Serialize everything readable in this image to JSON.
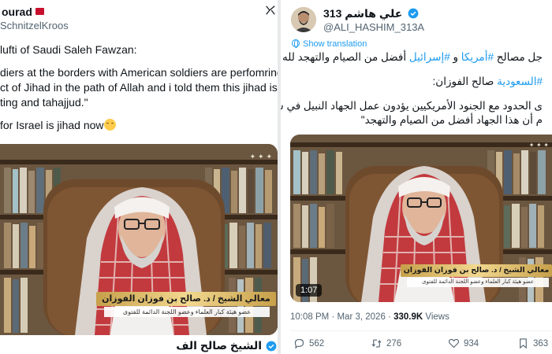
{
  "left": {
    "name_fragment": "ourad",
    "handle": "SchnitzelKroos",
    "lines": [
      "lufti of Saudi Saleh Fawzan:",
      "",
      "diers at the borders with American soldiers are perfomring th",
      "ct of Jihad in the path of Allah and i told them this jihad is bet",
      "ting and tahajjud.\"",
      "",
      "for Israel is jihad now"
    ],
    "footer_name": "الشيخ صالح الف"
  },
  "right": {
    "name": "علي هاشم 313",
    "handle": "@ALI_HASHIM_313A",
    "show_translation": "Show translation",
    "text": {
      "line1_prefix": "جل مصالح",
      "hashtag_america": "#أمريكا",
      "line1_mid": "و",
      "hashtag_israel": "#إسرائيل",
      "line1_suffix": "أفضل من الصيام والتهجد لله عزّ وجل",
      "hashtag_saudi": "#السعودية",
      "line2_suffix": "صالح الفوزان:",
      "line3": "ى الحدود مع الجنود الأمريكيين يؤدون عمل الجهاد النبيل في سبيل الله،",
      "line4": "م أن هذا الجهاد أفضل من الصيام والتهجد\""
    },
    "video": {
      "duration": "1:07"
    },
    "meta": {
      "time": "10:08 PM",
      "date": "Mar 3, 2026",
      "views": "330.9K",
      "views_label": "Views"
    },
    "actions": {
      "replies": "562",
      "reposts": "276",
      "likes": "934",
      "bookmarks": "363"
    }
  },
  "video_overlay": {
    "title_line": "معالي الشيخ / د. صالح بن فوزان الفوزان",
    "sub_line": "عضو هيئة كبار العلماء وعضو اللجنة الدائمة للفتوى"
  },
  "colors": {
    "accent": "#1d9bf0",
    "text": "#0f1419",
    "muted": "#536471",
    "flag": "#c8102e"
  },
  "icons": [
    "x-logo-icon",
    "flag-icon",
    "verified-icon",
    "globe-icon",
    "reply-icon",
    "repost-icon",
    "like-icon",
    "bookmark-icon"
  ]
}
